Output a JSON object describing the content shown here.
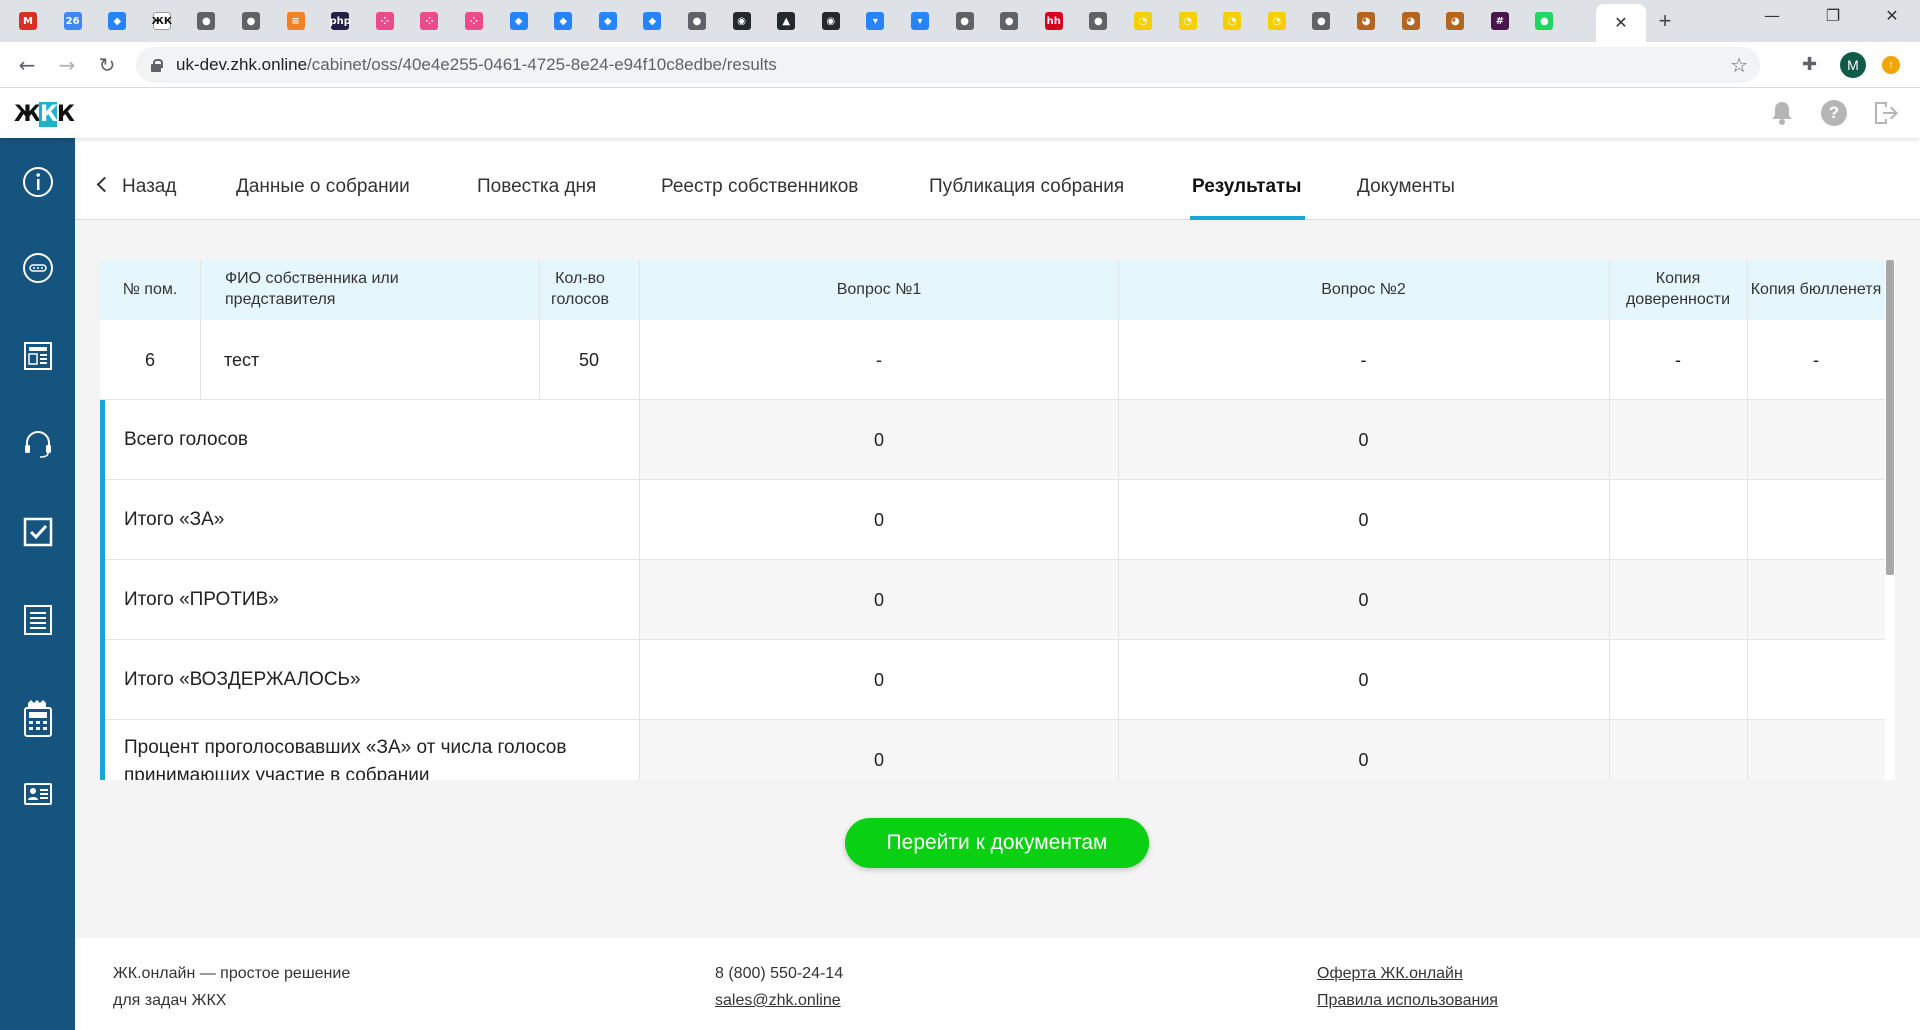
{
  "browser": {
    "url_host": "uk-dev.zhk.online",
    "url_path": "/cabinet/oss/40e4e255-0461-4725-8e24-e94f10c8edbe/results",
    "active_tab_close": "✕",
    "new_tab": "+",
    "profile_initial": "M",
    "tab_favicons": [
      {
        "glyph": "M",
        "color": "#d93025"
      },
      {
        "glyph": "26",
        "color": "#4285f4"
      },
      {
        "glyph": "◆",
        "color": "#2684ff"
      },
      {
        "glyph": "ЖК",
        "color": "#ffffff"
      },
      {
        "glyph": "●",
        "color": "#5f6368"
      },
      {
        "glyph": "●",
        "color": "#5f6368"
      },
      {
        "glyph": "≡",
        "color": "#f48024"
      },
      {
        "glyph": "php",
        "color": "#231f46"
      },
      {
        "glyph": "⁘",
        "color": "#e94c89"
      },
      {
        "glyph": "⁘",
        "color": "#e94c89"
      },
      {
        "glyph": "⁘",
        "color": "#e94c89"
      },
      {
        "glyph": "◆",
        "color": "#2684ff"
      },
      {
        "glyph": "◆",
        "color": "#2684ff"
      },
      {
        "glyph": "◆",
        "color": "#2684ff"
      },
      {
        "glyph": "◆",
        "color": "#2684ff"
      },
      {
        "glyph": "●",
        "color": "#5f6368"
      },
      {
        "glyph": "◉",
        "color": "#24292e"
      },
      {
        "glyph": "▲",
        "color": "#24292e"
      },
      {
        "glyph": "◉",
        "color": "#24292e"
      },
      {
        "glyph": "▾",
        "color": "#2684ff"
      },
      {
        "glyph": "▾",
        "color": "#2684ff"
      },
      {
        "glyph": "●",
        "color": "#5f6368"
      },
      {
        "glyph": "●",
        "color": "#5f6368"
      },
      {
        "glyph": "hh",
        "color": "#d6001c"
      },
      {
        "glyph": "●",
        "color": "#5f6368"
      },
      {
        "glyph": "◔",
        "color": "#f5d000"
      },
      {
        "glyph": "◔",
        "color": "#f5d000"
      },
      {
        "glyph": "◔",
        "color": "#f5d000"
      },
      {
        "glyph": "◔",
        "color": "#f5d000"
      },
      {
        "glyph": "●",
        "color": "#5f6368"
      },
      {
        "glyph": "◕",
        "color": "#b5651d"
      },
      {
        "glyph": "◕",
        "color": "#b5651d"
      },
      {
        "glyph": "◕",
        "color": "#b5651d"
      },
      {
        "glyph": "#",
        "color": "#4a154b"
      },
      {
        "glyph": "●",
        "color": "#1ed760"
      }
    ]
  },
  "app": {
    "logo": {
      "left": "Ж",
      "mid": "К",
      "right": "К"
    },
    "tabs": [
      {
        "label": "Назад",
        "name": "tab-back"
      },
      {
        "label": "Данные о собрании",
        "name": "tab-meeting-data"
      },
      {
        "label": "Повестка дня",
        "name": "tab-agenda"
      },
      {
        "label": "Реестр собственников",
        "name": "tab-owners-registry"
      },
      {
        "label": "Публикация собрания",
        "name": "tab-publication"
      },
      {
        "label": "Результаты",
        "name": "tab-results"
      },
      {
        "label": "Документы",
        "name": "tab-documents"
      }
    ],
    "active_tab": "Результаты",
    "accent_color": "#1aa6d8",
    "sidebar_color": "#14547e",
    "sidebar_icons": [
      "info-icon",
      "chat-icon",
      "news-icon",
      "support-headset-icon",
      "checkbox-icon",
      "document-list-icon",
      "calculator-icon",
      "contact-card-icon"
    ]
  },
  "table": {
    "headers": {
      "room_no": "№ пом.",
      "owner": "ФИО собственника или представителя",
      "votes": "Кол-во голосов",
      "q1": "Вопрос №1",
      "q2": "Вопрос №2",
      "proxy_copy": "Копия доверенности",
      "ballot_copy": "Копия бюлленетя"
    },
    "rows": [
      {
        "room_no": "6",
        "owner": "тест",
        "votes": "50",
        "q1": "-",
        "q2": "-",
        "proxy_copy": "-",
        "ballot_copy": "-"
      }
    ],
    "summary": [
      {
        "label": "Всего голосов",
        "q1": "0",
        "q2": "0"
      },
      {
        "label": "Итого «ЗА»",
        "q1": "0",
        "q2": "0"
      },
      {
        "label": "Итого «ПРОТИВ»",
        "q1": "0",
        "q2": "0"
      },
      {
        "label": "Итого «ВОЗДЕРЖАЛОСЬ»",
        "q1": "0",
        "q2": "0"
      },
      {
        "label": "Процент проголосовавших «ЗА» от числа голосов принимающих участие в собрании",
        "q1": "0",
        "q2": "0"
      }
    ]
  },
  "cta": {
    "label": "Перейти к документам",
    "color": "#09d013"
  },
  "footer": {
    "tagline_line1": "ЖК.онлайн — простое решение",
    "tagline_line2": "для задач ЖКХ",
    "phone": "8 (800) 550-24-14",
    "email": "sales@zhk.online",
    "offer_link": "Оферта ЖК.онлайн",
    "rules_link": "Правила использования"
  }
}
